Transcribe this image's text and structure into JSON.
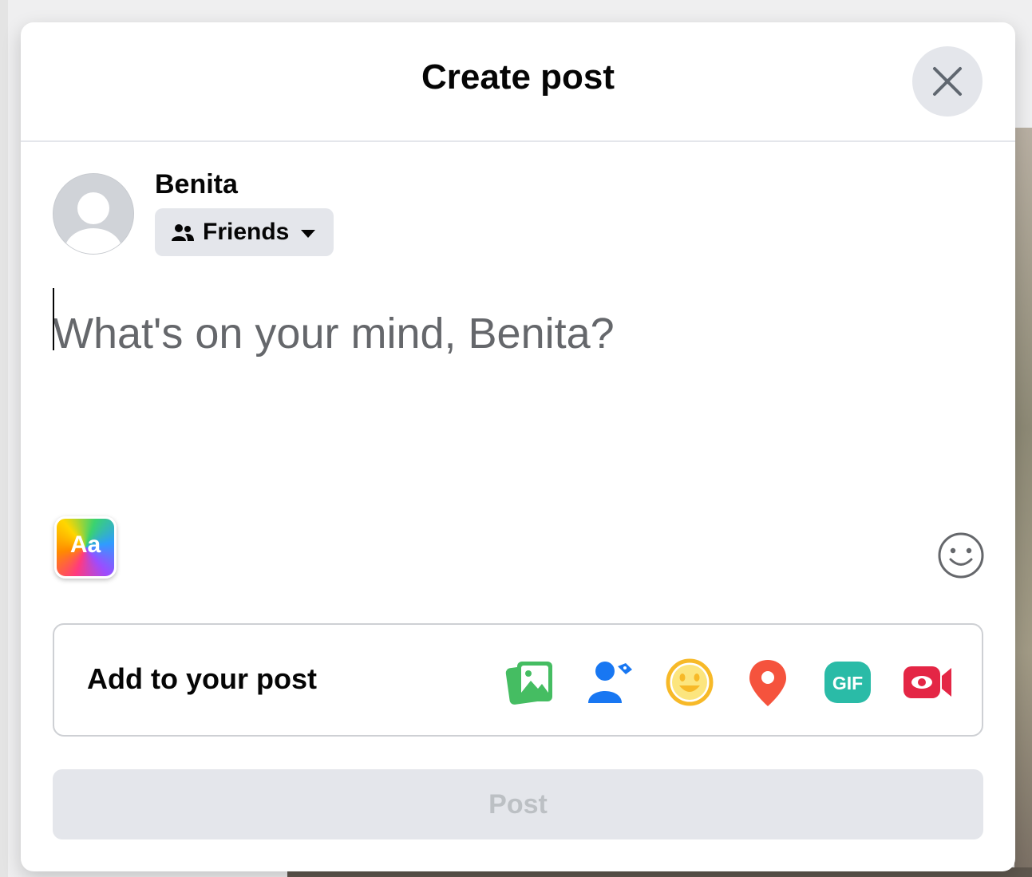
{
  "modal": {
    "title": "Create post",
    "close_label": "Close"
  },
  "user": {
    "name": "Benita",
    "audience": "Friends"
  },
  "composer": {
    "placeholder": "What's on your mind, Benita?",
    "value": ""
  },
  "add_to_post": {
    "label": "Add to your post",
    "icons": [
      {
        "name": "photo-video-icon",
        "color": "#45bd62"
      },
      {
        "name": "tag-people-icon",
        "color": "#1877f2"
      },
      {
        "name": "feeling-activity-icon",
        "color": "#f7b928"
      },
      {
        "name": "check-in-icon",
        "color": "#f5533d"
      },
      {
        "name": "gif-icon",
        "color": "#2abba7"
      },
      {
        "name": "live-video-icon",
        "color": "#e42645"
      }
    ],
    "gif_text": "GIF"
  },
  "text_background": {
    "label": "Aa"
  },
  "post_button": {
    "label": "Post"
  },
  "colors": {
    "surface": "#ffffff",
    "button_gray": "#e4e6eb",
    "primary_text": "#050505",
    "secondary_text": "#65676b",
    "disabled_text": "#bcc0c4"
  }
}
